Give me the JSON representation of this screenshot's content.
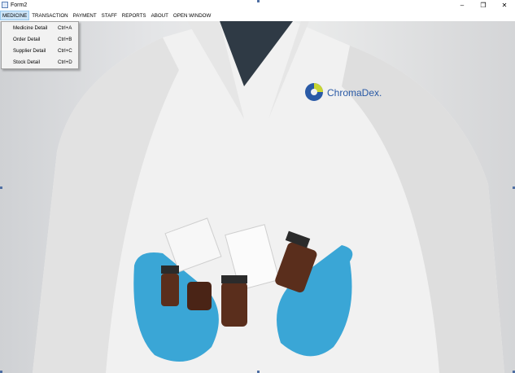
{
  "window": {
    "title": "Form2",
    "controls": {
      "minimize": "–",
      "maximize": "❐",
      "close": "✕"
    }
  },
  "menubar": {
    "items": [
      {
        "label": "MEDICINE",
        "active": true
      },
      {
        "label": "TRANSACTION"
      },
      {
        "label": "PAYMENT"
      },
      {
        "label": "STAFF"
      },
      {
        "label": "REPORTS"
      },
      {
        "label": "ABOUT"
      },
      {
        "label": "OPEN WINDOW"
      }
    ]
  },
  "dropdown": {
    "items": [
      {
        "label": "Medicine Detail",
        "shortcut": "Ctrl+A"
      },
      {
        "label": "Order Detail",
        "shortcut": "Ctrl+B"
      },
      {
        "label": "Supplier Detail",
        "shortcut": "Ctrl+C"
      },
      {
        "label": "Stock Detail",
        "shortcut": "Ctrl+D"
      }
    ]
  },
  "background": {
    "logo_text": "ChromaDex.",
    "colors": {
      "coat": "#eeeeee",
      "glove": "#3aa6d6",
      "bottle": "#5a2e1c",
      "logo": "#2a5aa6",
      "logo_accent": "#c9d631"
    }
  }
}
